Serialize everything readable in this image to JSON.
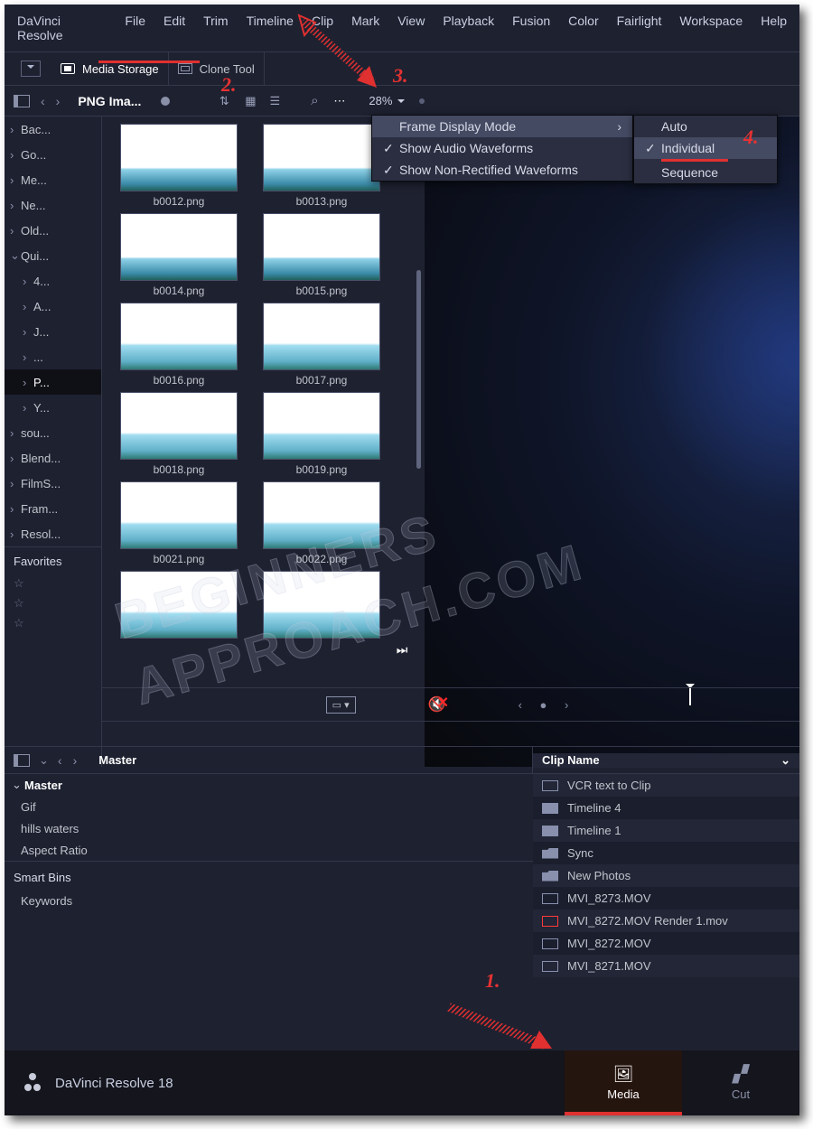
{
  "menu": [
    "DaVinci Resolve",
    "File",
    "Edit",
    "Trim",
    "Timeline",
    "Clip",
    "Mark",
    "View",
    "Playback",
    "Fusion",
    "Color",
    "Fairlight",
    "Workspace",
    "Help"
  ],
  "tools": {
    "media_storage": "Media Storage",
    "clone_tool": "Clone Tool"
  },
  "bar3_title": "PNG Ima...",
  "zoom": "28%",
  "tree": [
    {
      "t": "Bac...",
      "i": 0
    },
    {
      "t": "Go...",
      "i": 0
    },
    {
      "t": "Me...",
      "i": 0
    },
    {
      "t": "Ne...",
      "i": 0
    },
    {
      "t": "Old...",
      "i": 0
    },
    {
      "t": "Qui...",
      "i": 0,
      "open": true
    },
    {
      "t": "4...",
      "i": 1
    },
    {
      "t": "A...",
      "i": 1
    },
    {
      "t": "J...",
      "i": 1
    },
    {
      "t": "...",
      "i": 1
    },
    {
      "t": "P...",
      "i": 1,
      "sel": true
    },
    {
      "t": "Y...",
      "i": 1
    },
    {
      "t": "sou...",
      "i": 0
    },
    {
      "t": "Blend...",
      "i": 0
    },
    {
      "t": "FilmS...",
      "i": 0
    },
    {
      "t": "Fram...",
      "i": 0
    },
    {
      "t": "Resol...",
      "i": 0
    }
  ],
  "favorites_label": "Favorites",
  "thumbs": [
    "b0012.png",
    "b0013.png",
    "b0014.png",
    "b0015.png",
    "b0016.png",
    "b0017.png",
    "b0018.png",
    "b0019.png",
    "b0021.png",
    "b0022.png",
    "",
    ""
  ],
  "ctx1": {
    "head": "Frame Display Mode",
    "a": "Show Audio Waveforms",
    "b": "Show Non-Rectified Waveforms"
  },
  "ctx2": [
    "Auto",
    "Individual",
    "Sequence"
  ],
  "ann": {
    "n1": "1.",
    "n2": "2.",
    "n3": "3.",
    "n4": "4."
  },
  "lower": {
    "master": "Master",
    "tree": [
      "Master",
      "Gif",
      "hills waters",
      "Aspect Ratio"
    ],
    "smart_bins": "Smart Bins",
    "keywords": "Keywords",
    "clip_head": "Clip Name",
    "clips": [
      {
        "n": "VCR text to Clip",
        "ic": "clip"
      },
      {
        "n": "Timeline 4",
        "ic": "tl"
      },
      {
        "n": "Timeline 1",
        "ic": "tl"
      },
      {
        "n": "Sync",
        "ic": "folder"
      },
      {
        "n": "New Photos",
        "ic": "folder"
      },
      {
        "n": "MVI_8273.MOV",
        "ic": "clip"
      },
      {
        "n": "MVI_8272.MOV Render 1.mov",
        "ic": "red"
      },
      {
        "n": "MVI_8272.MOV",
        "ic": "clip"
      },
      {
        "n": "MVI_8271.MOV",
        "ic": "clip"
      }
    ]
  },
  "bottom": {
    "app": "DaVinci Resolve 18",
    "tabs": [
      {
        "l": "Media",
        "active": true
      },
      {
        "l": "Cut"
      }
    ]
  },
  "watermark": "BEGINNERS\nAPPROACH.COM"
}
